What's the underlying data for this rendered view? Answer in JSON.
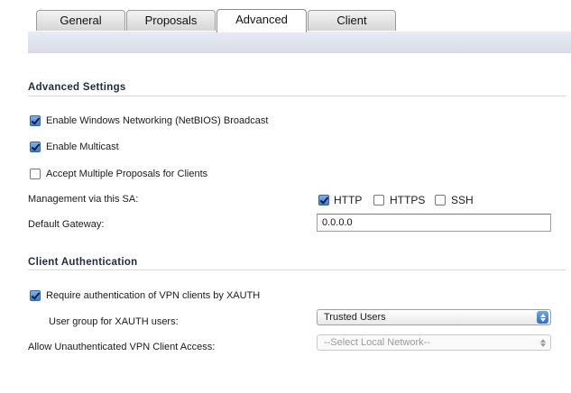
{
  "tabs": {
    "general": "General",
    "proposals": "Proposals",
    "advanced": "Advanced",
    "client": "Client",
    "active": "Advanced"
  },
  "advanced_settings": {
    "title": "Advanced Settings",
    "netbios": {
      "label": "Enable Windows Networking (NetBIOS) Broadcast",
      "checked": true
    },
    "multicast": {
      "label": "Enable Multicast",
      "checked": true
    },
    "multiple_proposals": {
      "label": "Accept Multiple Proposals for Clients",
      "checked": false
    },
    "management": {
      "label": "Management via this SA:",
      "http": {
        "label": "HTTP",
        "checked": true
      },
      "https": {
        "label": "HTTPS",
        "checked": false
      },
      "ssh": {
        "label": "SSH",
        "checked": false
      }
    },
    "default_gateway": {
      "label": "Default Gateway:",
      "value": "0.0.0.0"
    }
  },
  "client_authentication": {
    "title": "Client Authentication",
    "require_xauth": {
      "label": "Require authentication of VPN clients by XAUTH",
      "checked": true
    },
    "user_group": {
      "label": "User group for XAUTH users:",
      "selected": "Trusted Users"
    },
    "unauthenticated_access": {
      "label": "Allow Unauthenticated VPN Client Access:",
      "selected": "--Select Local Network--",
      "disabled": true
    }
  },
  "colors": {
    "accent": "#3c7fd1",
    "section_title": "#1f2a44",
    "tab_band": "#dde0ea"
  },
  "icons": {
    "checkbox_checked": "checkmark-icon",
    "select_arrows": "updown-arrows-icon"
  }
}
